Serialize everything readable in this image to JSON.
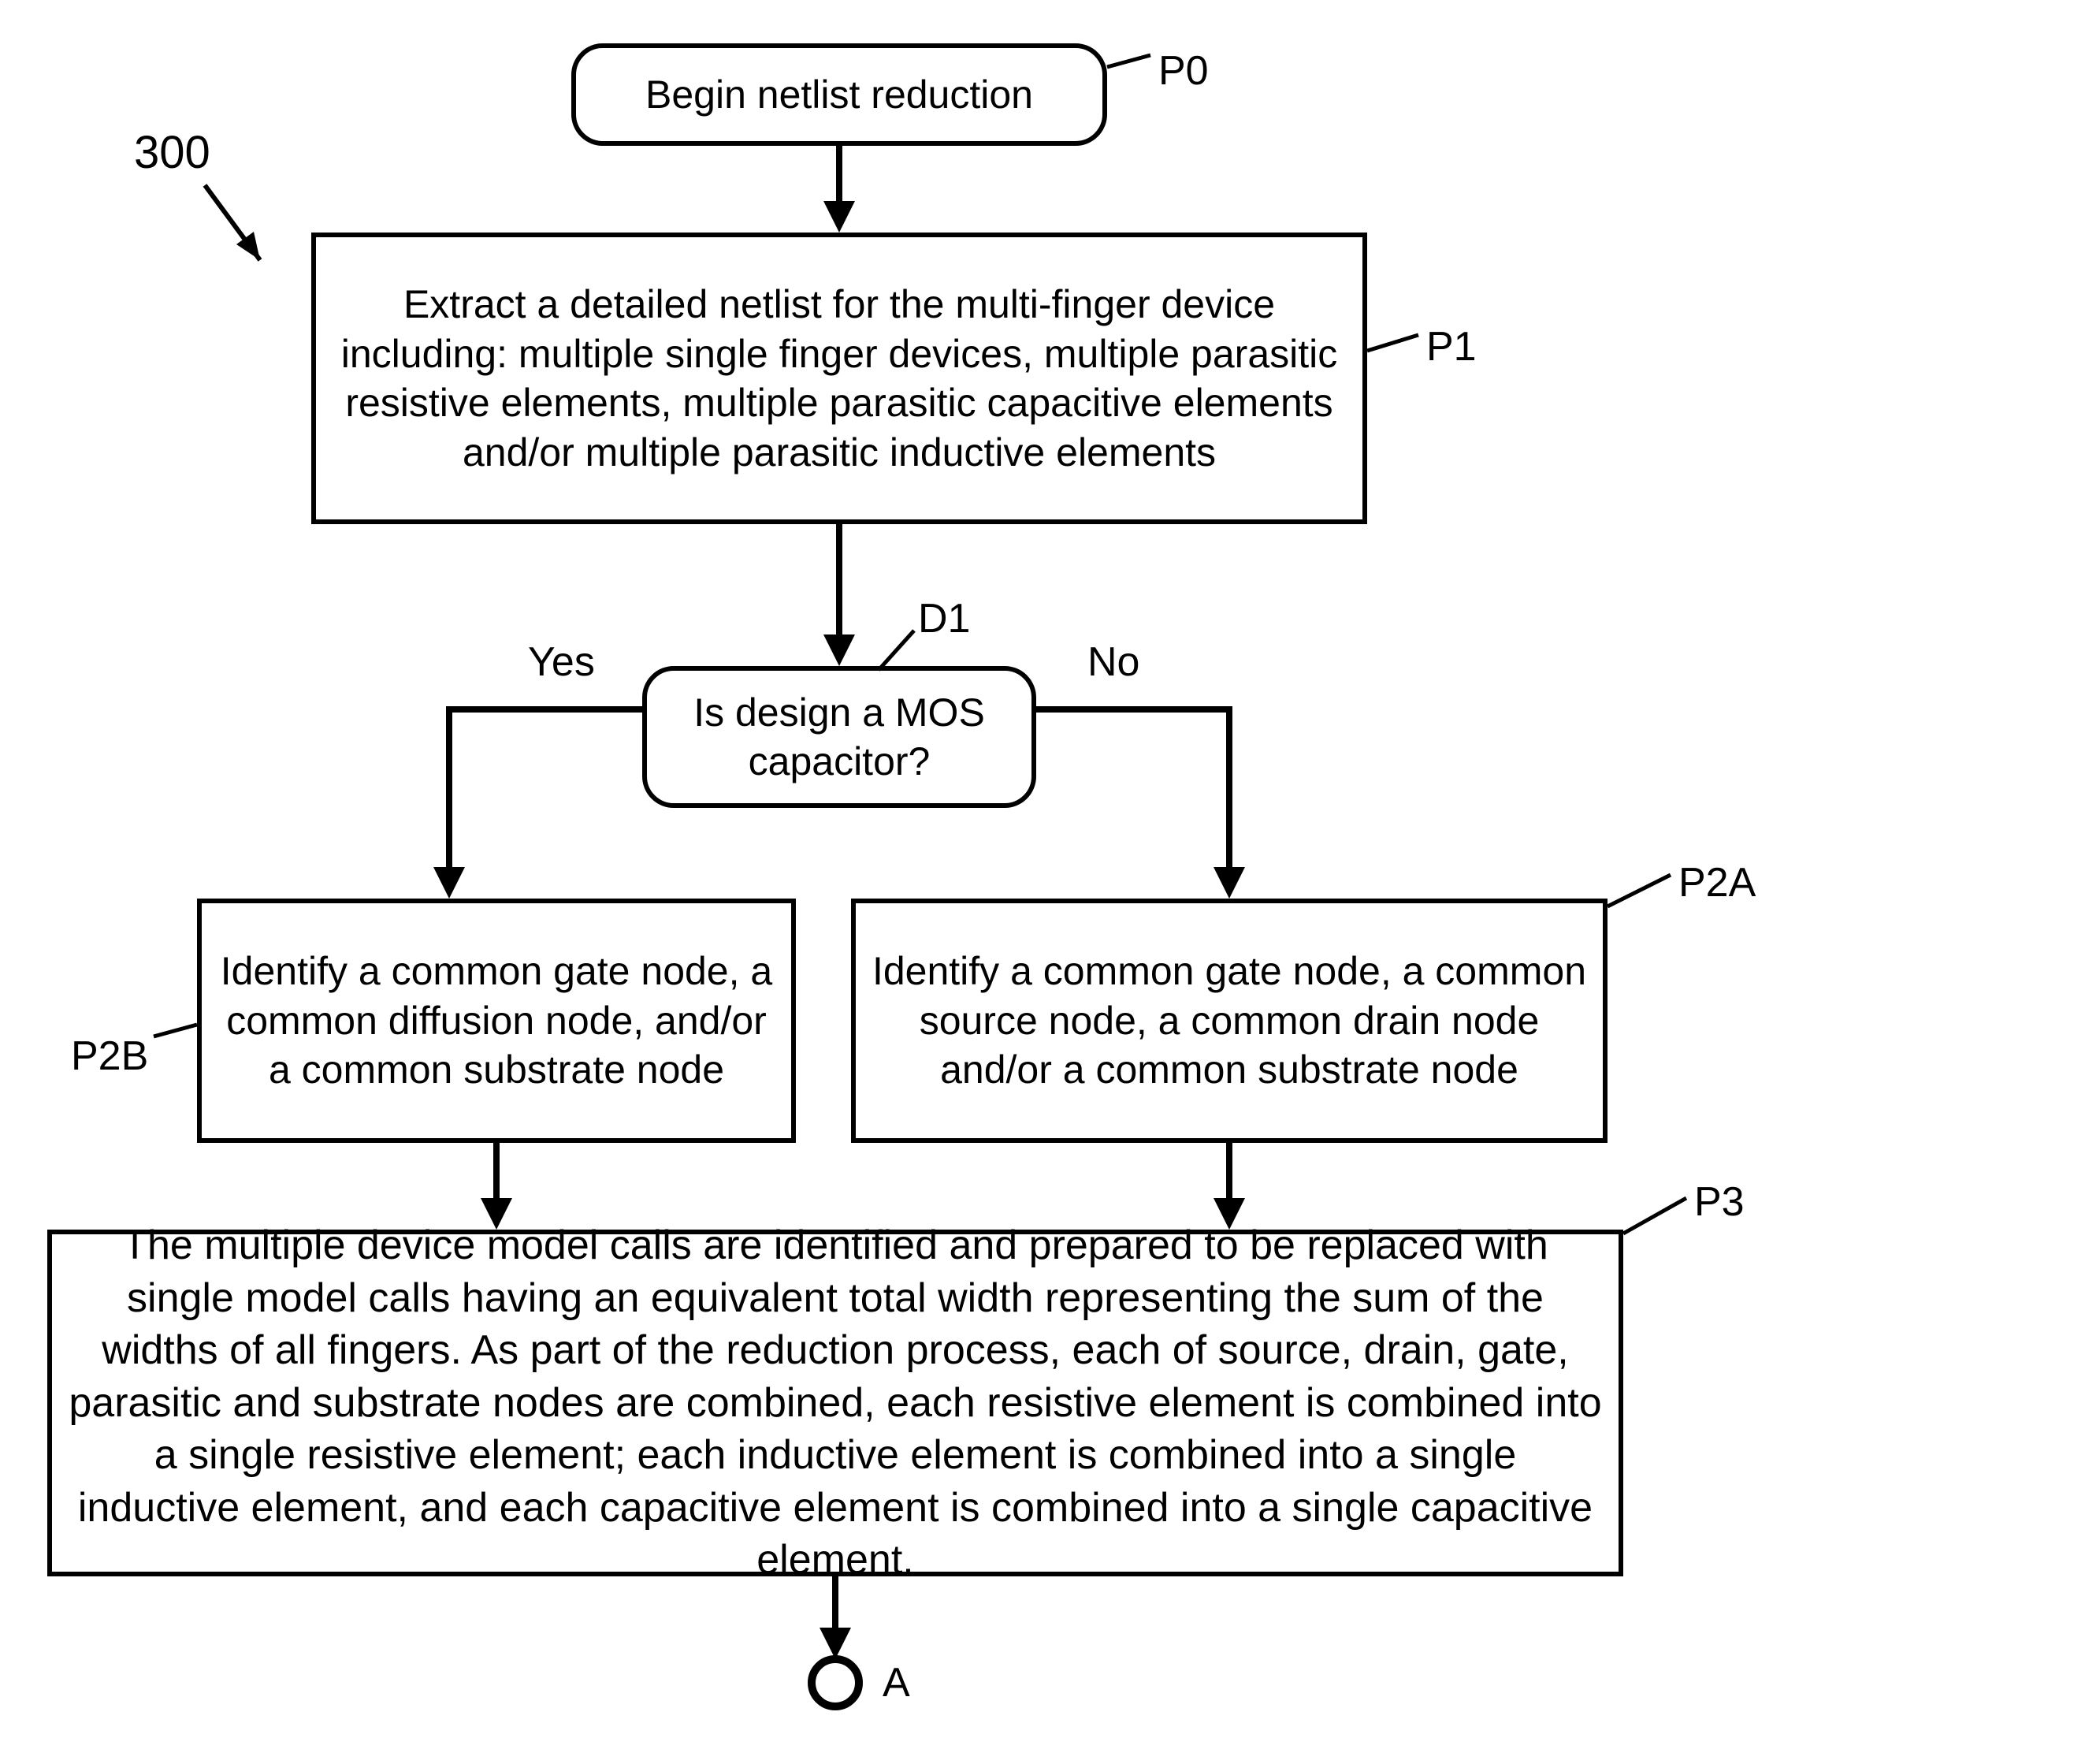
{
  "ref": "300",
  "nodes": {
    "P0": {
      "label": "P0",
      "text": "Begin netlist reduction"
    },
    "P1": {
      "label": "P1",
      "text": "Extract a detailed netlist for the multi-finger device including: multiple single finger devices, multiple parasitic resistive elements, multiple parasitic capacitive elements and/or multiple parasitic inductive elements"
    },
    "D1": {
      "label": "D1",
      "text": "Is design a MOS capacitor?",
      "yes": "Yes",
      "no": "No"
    },
    "P2B": {
      "label": "P2B",
      "text": "Identify a common gate node, a common diffusion node, and/or a common substrate node"
    },
    "P2A": {
      "label": "P2A",
      "text": "Identify a common gate node, a common source node, a common drain node and/or a common substrate node"
    },
    "P3": {
      "label": "P3",
      "text": "The multiple device model calls are identified and prepared to be replaced with single model calls having an equivalent total width representing the sum of the widths of all fingers.  As part of the reduction process, each of source, drain, gate, parasitic and substrate nodes are combined, each resistive element is combined into a single resistive element; each inductive element is combined into a single inductive element, and each capacitive element is combined into a single capacitive element."
    }
  },
  "connector": "A"
}
